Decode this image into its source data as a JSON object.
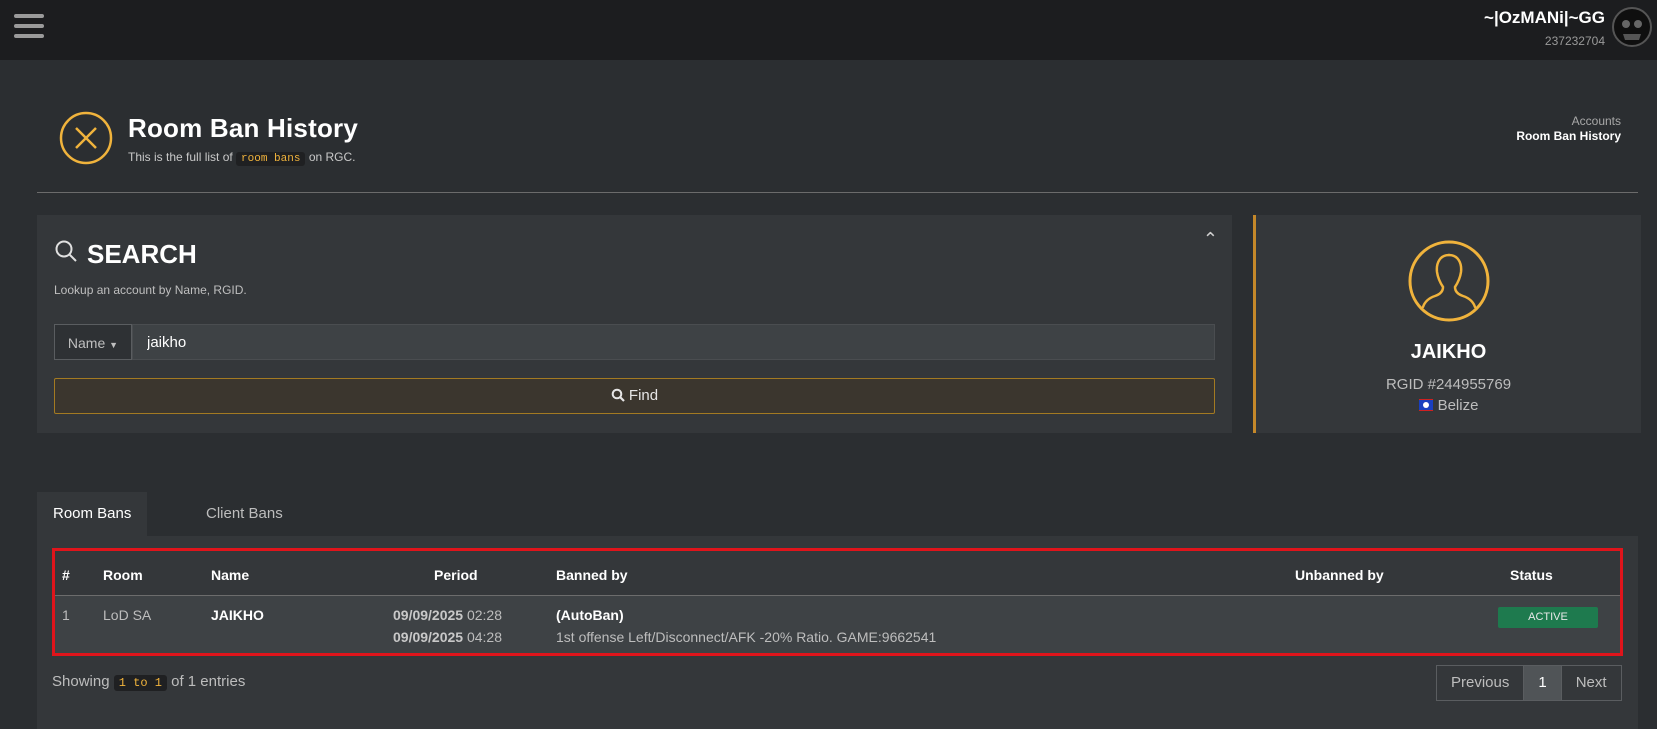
{
  "topbar": {
    "username": "~|OzMANi|~GG",
    "user_id": "237232704"
  },
  "page": {
    "title": "Room Ban History",
    "subtitle_prefix": "This is the full list of",
    "subtitle_code": "room bans",
    "subtitle_suffix": "on RGC.",
    "breadcrumb": [
      "Accounts",
      "Room Ban History"
    ]
  },
  "search": {
    "title": "SEARCH",
    "description": "Lookup an account by Name, RGID.",
    "type_label": "Name",
    "value": "jaikho",
    "button": "Find"
  },
  "profile": {
    "name": "JAIKHO",
    "rgid": "RGID #244955769",
    "country": "Belize"
  },
  "tabs": [
    "Room Bans",
    "Client Bans"
  ],
  "table": {
    "headers": [
      "#",
      "Room",
      "Name",
      "Period",
      "Banned by",
      "Unbanned by",
      "Status"
    ],
    "rows": [
      {
        "num": "1",
        "room": "LoD SA",
        "name": "JAIKHO",
        "start_date": "09/09/2025",
        "start_time": "02:28",
        "end_date": "09/09/2025",
        "end_time": "04:28",
        "banned_by": "(AutoBan)",
        "reason": "1st offense Left/Disconnect/AFK -20% Ratio. GAME:9662541",
        "unbanned_by": "",
        "status": "ACTIVE"
      }
    ]
  },
  "footer": {
    "showing_prefix": "Showing",
    "showing_range": "1 to 1",
    "showing_suffix": "of 1 entries",
    "pagination": [
      "Previous",
      "1",
      "Next"
    ]
  },
  "colors": {
    "accent": "#f0b33c",
    "active_badge": "#1e7a4e",
    "highlight": "#e0141b"
  }
}
